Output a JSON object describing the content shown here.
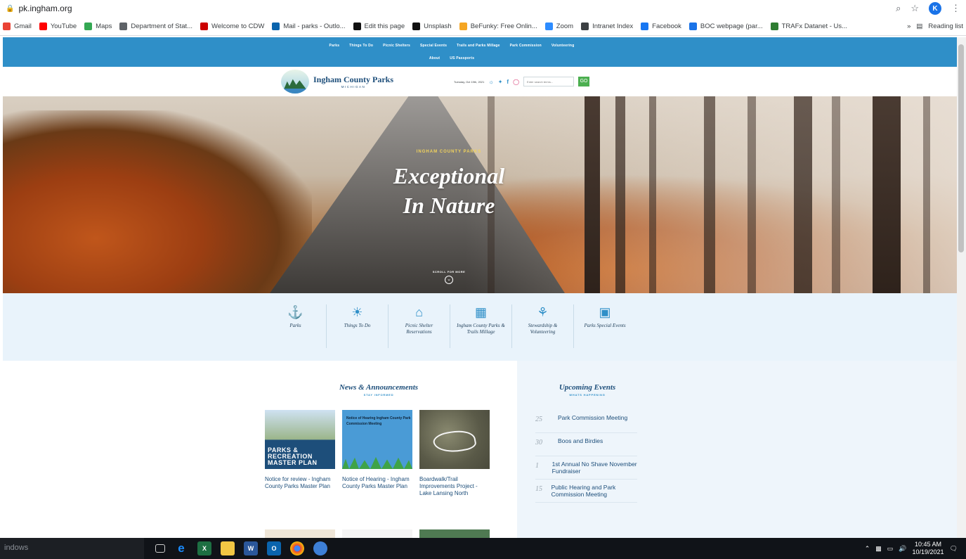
{
  "browser": {
    "url": "pk.ingham.org",
    "avatar_letter": "K",
    "bookmarks": [
      {
        "label": "Gmail",
        "color": "#ea4335"
      },
      {
        "label": "YouTube",
        "color": "#ff0000"
      },
      {
        "label": "Maps",
        "color": "#34a853"
      },
      {
        "label": "Department of Stat...",
        "color": "#5f6368"
      },
      {
        "label": "Welcome to CDW",
        "color": "#cc0000"
      },
      {
        "label": "Mail - parks - Outlo...",
        "color": "#0a64ad"
      },
      {
        "label": "Edit this page",
        "color": "#111111"
      },
      {
        "label": "Unsplash",
        "color": "#111111"
      },
      {
        "label": "BeFunky: Free Onlin...",
        "color": "#f5a623"
      },
      {
        "label": "Zoom",
        "color": "#2d8cff"
      },
      {
        "label": "Intranet Index",
        "color": "#3c4043"
      },
      {
        "label": "Facebook",
        "color": "#1877f2"
      },
      {
        "label": "BOC webpage (par...",
        "color": "#1a73e8"
      },
      {
        "label": "TRAFx Datanet - Us...",
        "color": "#2e7d32"
      }
    ],
    "more": "»",
    "reading_list": "Reading list"
  },
  "nav": {
    "row1": [
      "Parks",
      "Things To Do",
      "Picnic Shelters",
      "Special Events",
      "Trails and Parks Millage",
      "Park Commission",
      "Volunteering"
    ],
    "row2": [
      "About",
      "US Passports"
    ]
  },
  "brand": {
    "name": "Ingham County Parks",
    "state": "MICHIGAN",
    "date": "Tuesday, Oct 19th, 2021",
    "search_placeholder": "Enter search terms...",
    "go": "GO"
  },
  "hero": {
    "kicker": "INGHAM COUNTY PARKS",
    "line1": "Exceptional",
    "line2": "In Nature",
    "scroll": "SCROLL FOR MORE"
  },
  "quick_links": [
    {
      "label": "Parks",
      "icon": "park-bench-icon"
    },
    {
      "label": "Things To Do",
      "icon": "sun-icon"
    },
    {
      "label": "Picnic Shelter Reservations",
      "icon": "shelter-icon"
    },
    {
      "label": "Ingham County Parks & Trails Millage",
      "icon": "map-icon"
    },
    {
      "label": "Stewardship & Volunteering",
      "icon": "volunteer-icon"
    },
    {
      "label": "Parks Special Events",
      "icon": "calendar-icon"
    }
  ],
  "news": {
    "title": "News & Announcements",
    "subtitle": "STAY INFORMED",
    "items": [
      {
        "caption": "Notice for review - Ingham County Parks Master Plan",
        "overlay": "PARKS & RECREATION MASTER PLAN"
      },
      {
        "caption": "Notice of Hearing - Ingham County Parks Master Plan",
        "overlay": "Notice of Hearing Ingham County Park Commission Meeting"
      },
      {
        "caption": "Boardwalk/Trail Improvements Project - Lake Lansing North",
        "overlay": ""
      }
    ]
  },
  "events": {
    "title": "Upcoming Events",
    "subtitle": "WHATS HAPPENING",
    "items": [
      {
        "day": "25",
        "name": "Park Commission Meeting"
      },
      {
        "day": "30",
        "name": "Boos and Birdies"
      },
      {
        "day": "1",
        "name": "1st Annual No Shave November Fundraiser"
      },
      {
        "day": "15",
        "name": "Public Hearing and Park Commission Meeting"
      }
    ]
  },
  "taskbar": {
    "search": "indows",
    "time": "10:45 AM",
    "date": "10/19/2021"
  }
}
